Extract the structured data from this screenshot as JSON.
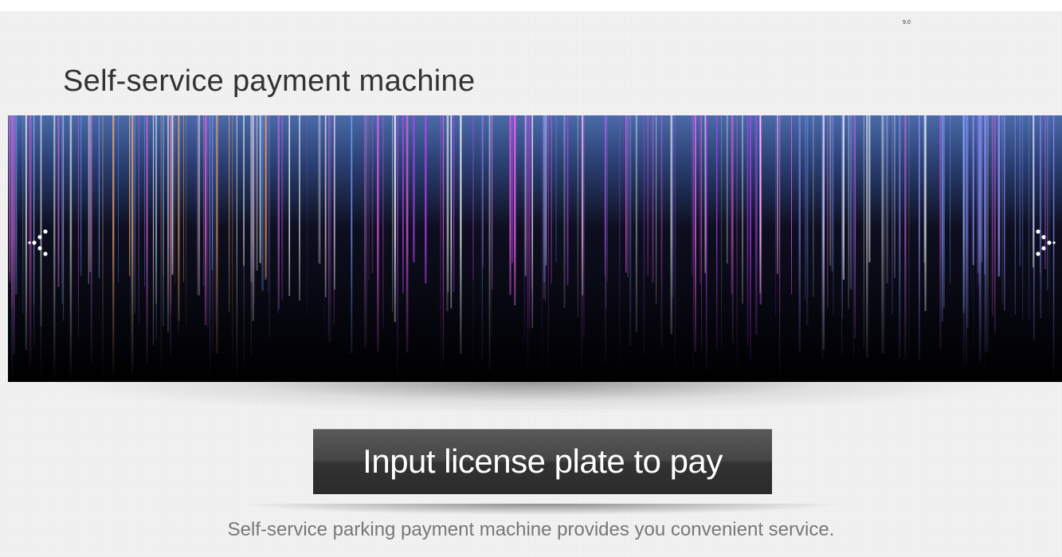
{
  "header": {
    "version": "9.0",
    "title": "Self-service payment machine"
  },
  "banner": {
    "colors": {
      "top": "#4a6aa8",
      "bottom": "#000000",
      "streak_palette": [
        "#c040ff",
        "#ff60ff",
        "#9090ff",
        "#ffffff",
        "#ffb070",
        "#e060e0",
        "#70a0ff"
      ]
    },
    "prev_icon": "chevron-dots-left",
    "next_icon": "chevron-dots-right"
  },
  "action": {
    "pay_button_label": "Input license plate to pay"
  },
  "footer": {
    "tagline": "Self-service parking payment machine provides you convenient service."
  }
}
